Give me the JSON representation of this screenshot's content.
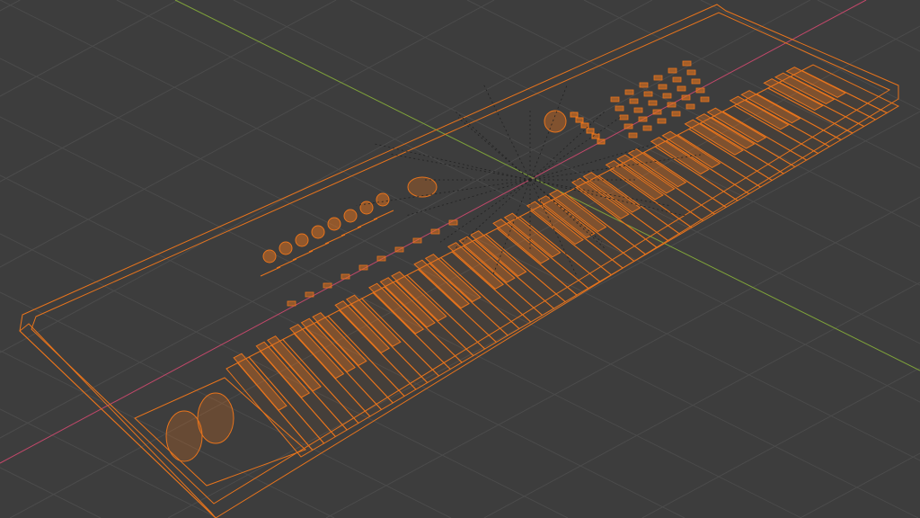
{
  "viewport": {
    "mode": "wireframe",
    "background_color": "#3d3d3d",
    "grid_color": "#4b4b4b",
    "x_axis_color": "#c2486a",
    "y_axis_color": "#7fa33a",
    "selection_color": "#e8741c",
    "object": "keyboard"
  }
}
